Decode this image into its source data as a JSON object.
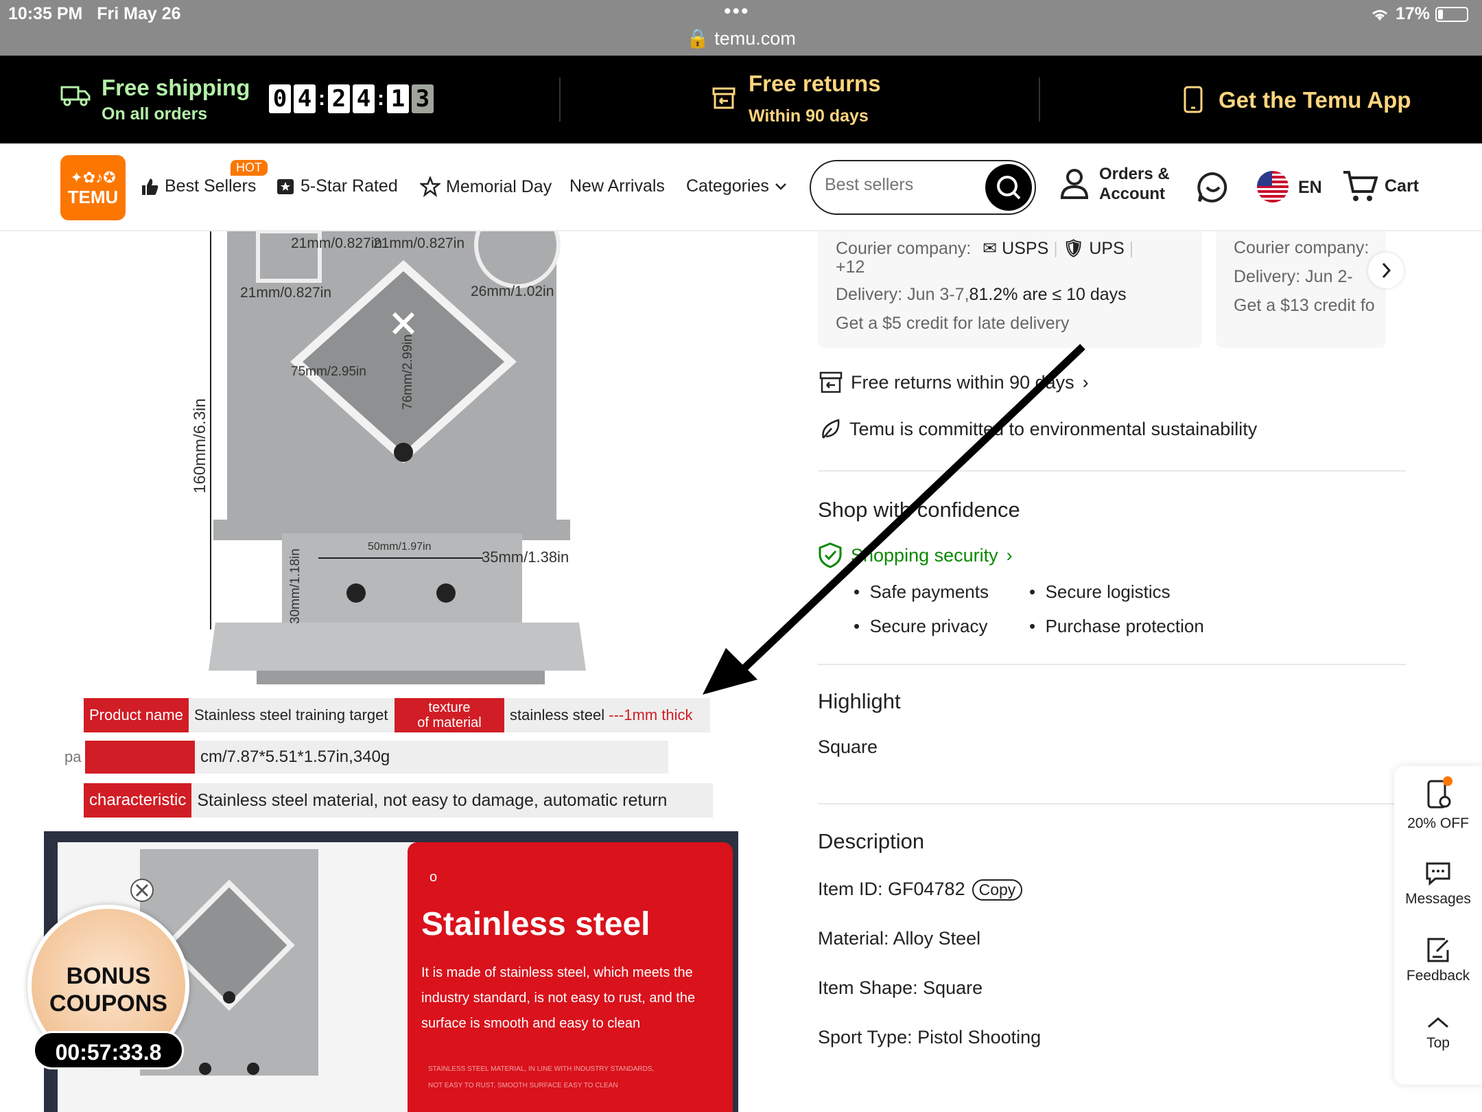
{
  "status_bar": {
    "time": "10:35 PM",
    "date": "Fri May 26",
    "battery": "17%",
    "url": "temu.com"
  },
  "promo": {
    "shipping_title": "Free shipping",
    "shipping_sub": "On all orders",
    "timer_digits": [
      "0",
      "4",
      "2",
      "4",
      "1",
      "3"
    ],
    "returns_title": "Free returns",
    "returns_sub": "Within 90 days",
    "app_label": "Get the Temu App"
  },
  "nav": {
    "logo_text": "TEMU",
    "hot_badge": "HOT",
    "items": [
      "Best Sellers",
      "5-Star Rated",
      "Memorial Day",
      "New Arrivals",
      "Categories"
    ],
    "search_placeholder": "Best sellers",
    "account_line1": "Orders &",
    "account_line2": "Account",
    "language": "EN",
    "cart": "Cart"
  },
  "product_image": {
    "dims": {
      "d1": "21mm/0.827in",
      "d2": "21mm/0.827in",
      "d3": "21mm/0.827in",
      "d4": "26mm/1.02in",
      "d5": "75mm/2.95in",
      "d6": "76mm/2.99in",
      "d7": "160mm/6.3in",
      "d8": "50mm/1.97in",
      "d9": "35mm/1.38in",
      "d10": "30mm/1.18in"
    },
    "specs": {
      "product_name_label": "Product name",
      "product_name_value": "Stainless steel training target",
      "texture_label_1": "texture",
      "texture_label_2": "of material",
      "texture_value": "stainless steel",
      "texture_extra": "---1mm thick",
      "packing_prefix": "pa",
      "packing_value": "cm/7.87*5.51*1.57in,340g",
      "characteristic_label": "characteristic",
      "characteristic_value": "Stainless steel material, not easy to damage, automatic return"
    },
    "promo_card": {
      "circle": "o",
      "title": "Stainless steel",
      "body": "It is made of stainless steel, which meets the industry standard, is not easy to rust, and the surface is smooth and easy to clean",
      "small1": "STAINLESS STEEL MATERIAL, IN LINE WITH INDUSTRY STANDARDS,",
      "small2": "NOT EASY TO RUST, SMOOTH SURFACE EASY TO CLEAN"
    }
  },
  "shipping_cards": [
    {
      "courier_label": "Courier company:",
      "courier1": "USPS",
      "courier2": "UPS",
      "more": "+12",
      "delivery_label": "Delivery: Jun 3-7,",
      "delivery_stat": "81.2% are ≤ 10 days",
      "credit": "Get a $5 credit for late delivery"
    },
    {
      "courier_label": "Courier company:",
      "delivery_label": "Delivery: Jun 2-",
      "credit": "Get a $13 credit fo"
    }
  ],
  "info": {
    "free_returns": "Free returns within 90 days",
    "sustainability": "Temu is committed to environmental sustainability",
    "shop_title": "Shop with confidence",
    "security_link": "Shopping security",
    "security_items": [
      "Safe payments",
      "Secure logistics",
      "Secure privacy",
      "Purchase protection"
    ],
    "highlight_title": "Highlight",
    "highlight_value": "Square",
    "description_title": "Description",
    "item_id": "Item ID: GF04782",
    "copy": "Copy",
    "material": "Material: Alloy Steel",
    "item_shape": "Item Shape: Square",
    "sport_type": "Sport Type: Pistol Shooting"
  },
  "side_widget": {
    "discount": "20% OFF",
    "messages": "Messages",
    "feedback": "Feedback",
    "top": "Top"
  },
  "bonus": {
    "line1": "BONUS",
    "line2": "COUPONS",
    "timer": "00:57:33.8"
  },
  "colors": {
    "brand": "#fb7701",
    "promo_green": "#b4f0a8",
    "promo_yellow": "#ffd57e",
    "security_green": "#0a8800",
    "spec_red": "#d11d25"
  }
}
